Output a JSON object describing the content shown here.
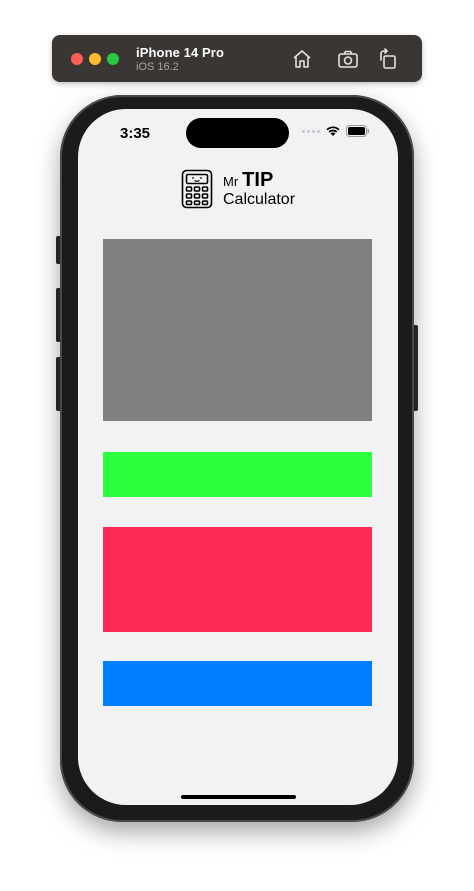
{
  "simulator": {
    "device_name": "iPhone 14 Pro",
    "os_version": "iOS 16.2",
    "icons": [
      "home-icon",
      "screenshot-camera-icon",
      "rotate-icon"
    ]
  },
  "status_bar": {
    "time": "3:35",
    "icons": [
      "cellular-dots-icon",
      "wifi-icon",
      "battery-icon"
    ]
  },
  "logo": {
    "prefix": "Mr",
    "title": "TIP",
    "subtitle": "Calculator",
    "icon": "calculator-icon"
  },
  "blocks": [
    {
      "name": "gray",
      "color": "#808080"
    },
    {
      "name": "green",
      "color": "#2bfe3c"
    },
    {
      "name": "red",
      "color": "#fe2c54"
    },
    {
      "name": "blue",
      "color": "#007fff"
    }
  ]
}
